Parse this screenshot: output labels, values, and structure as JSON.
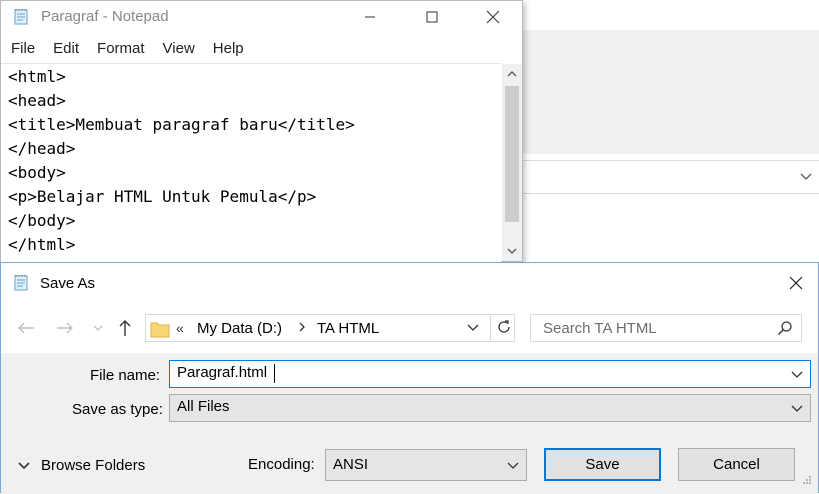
{
  "notepad": {
    "title": "Paragraf - Notepad",
    "menu": [
      "File",
      "Edit",
      "Format",
      "View",
      "Help"
    ],
    "lines": [
      "<html>",
      "<head>",
      "<title>Membuat paragraf baru</title>",
      "</head>",
      "<body>",
      "<p>Belajar HTML Untuk Pemula</p>",
      "</body>",
      "</html>"
    ]
  },
  "dialog": {
    "title": "Save As",
    "address": {
      "overflow": "«",
      "crumbs": [
        "My Data (D:)",
        "TA HTML"
      ]
    },
    "search_placeholder": "Search TA HTML",
    "file_name_label": "File name:",
    "file_name_value": "Paragraf.html",
    "save_as_type_label": "Save as type:",
    "save_as_type_value": "All Files",
    "browse_folders_label": "Browse Folders",
    "encoding_label": "Encoding:",
    "encoding_value": "ANSI",
    "save_label": "Save",
    "cancel_label": "Cancel"
  },
  "colors": {
    "accent": "#0078d7",
    "panel": "#f0f0f0",
    "title_inactive": "#888888"
  }
}
